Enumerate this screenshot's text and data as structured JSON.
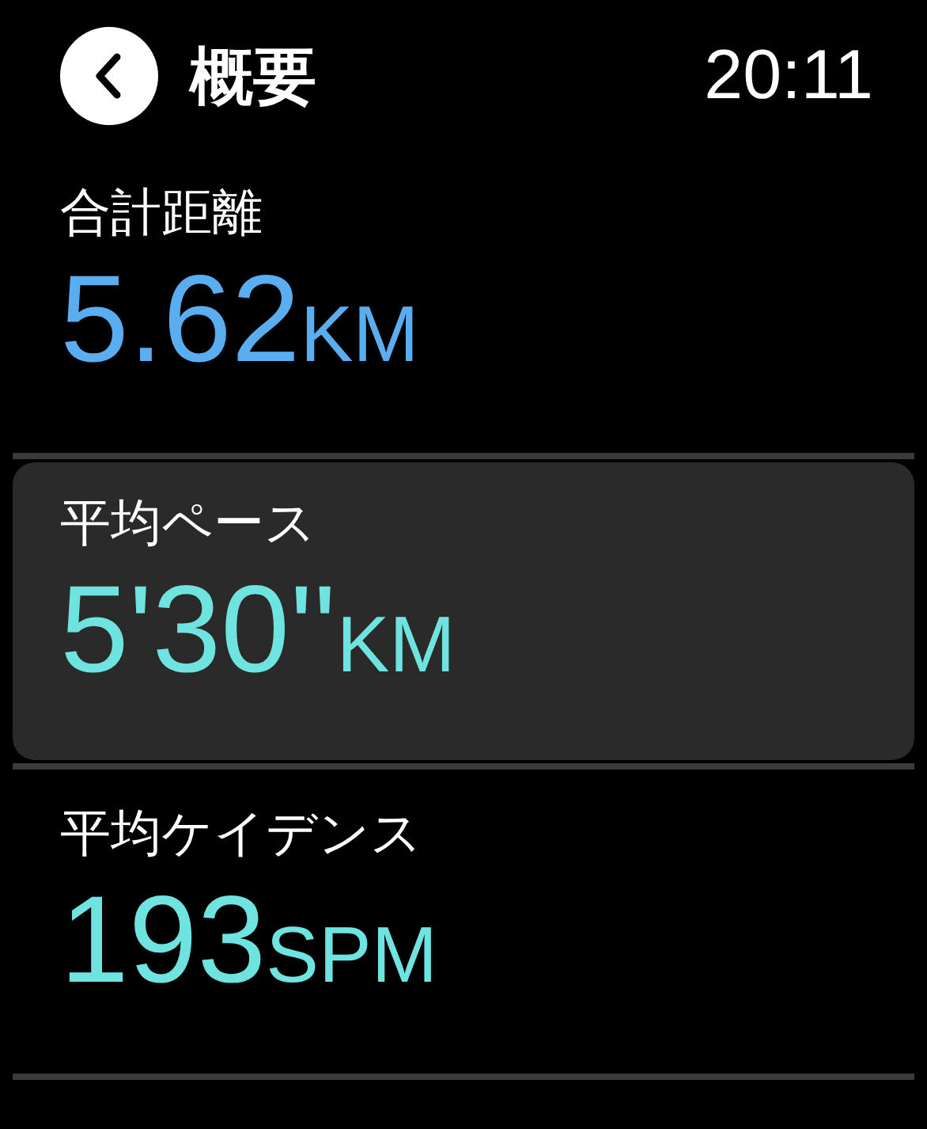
{
  "header": {
    "title": "概要",
    "time": "20:11"
  },
  "metrics": [
    {
      "label": "合計距離",
      "value": "5.62",
      "unit": "KM",
      "color": "#5aaef0",
      "selected": false
    },
    {
      "label": "平均ペース",
      "value": "5'30''",
      "unit": "KM",
      "color": "#6fe3df",
      "selected": true
    },
    {
      "label": "平均ケイデンス",
      "value": "193",
      "unit": "SPM",
      "color": "#6fe3df",
      "selected": false
    }
  ]
}
